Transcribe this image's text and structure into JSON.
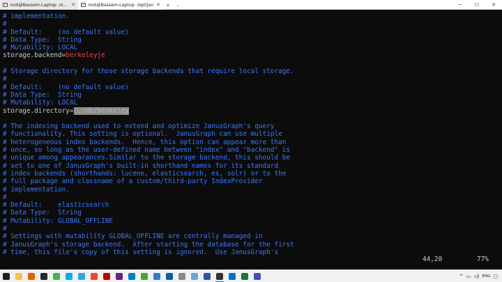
{
  "window": {
    "tabs": [
      {
        "label": "root@Bassem-Laptop: /opt/jan",
        "active": false
      },
      {
        "label": "root@Bassem-Laptop: /opt/jan",
        "active": true
      }
    ],
    "new_tab": "+",
    "dropdown": "⌄",
    "minimize": "─",
    "maximize": "☐",
    "close": "✕"
  },
  "terminal": {
    "lines": [
      {
        "type": "comment",
        "text": "# implementation."
      },
      {
        "type": "comment",
        "text": "#"
      },
      {
        "type": "comment",
        "text": "# Default:    (no default value)"
      },
      {
        "type": "comment",
        "text": "# Data Type:  String"
      },
      {
        "type": "comment",
        "text": "# Mutability: LOCAL"
      },
      {
        "type": "setting",
        "key": "storage.backend=",
        "value": "berkeleyje"
      },
      {
        "type": "blank",
        "text": ""
      },
      {
        "type": "comment",
        "text": "# Storage directory for those storage backends that require local storage."
      },
      {
        "type": "comment",
        "text": "#"
      },
      {
        "type": "comment",
        "text": "# Default:    (no default value)"
      },
      {
        "type": "comment",
        "text": "# Data Type:  String"
      },
      {
        "type": "comment",
        "text": "# Mutability: LOCAL"
      },
      {
        "type": "setting-selected",
        "key": "storage.directory=",
        "value": "../db/berkeley"
      },
      {
        "type": "blank",
        "text": ""
      },
      {
        "type": "comment",
        "text": "# The indexing backend used to extend and optimize JanusGraph's query"
      },
      {
        "type": "comment",
        "text": "# functionality. This setting is optional.  JanusGraph can use multiple"
      },
      {
        "type": "comment",
        "text": "# heterogeneous index backends.  Hence, this option can appear more than"
      },
      {
        "type": "comment",
        "text": "# once, so long as the user-defined name between \"index\" and \"backend\" is"
      },
      {
        "type": "comment",
        "text": "# unique among appearances.Similar to the storage backend, this should be"
      },
      {
        "type": "comment",
        "text": "# set to one of JanusGraph's built-in shorthand names for its standard"
      },
      {
        "type": "comment",
        "text": "# index backends (shorthands: lucene, elasticsearch, es, solr) or to the"
      },
      {
        "type": "comment",
        "text": "# full package and classname of a custom/third-party IndexProvider"
      },
      {
        "type": "comment",
        "text": "# implementation."
      },
      {
        "type": "comment",
        "text": "#"
      },
      {
        "type": "comment",
        "text": "# Default:    elasticsearch"
      },
      {
        "type": "comment",
        "text": "# Data Type:  String"
      },
      {
        "type": "comment",
        "text": "# Mutability: GLOBAL_OFFLINE"
      },
      {
        "type": "comment",
        "text": "#"
      },
      {
        "type": "comment",
        "text": "# Settings with mutability GLOBAL_OFFLINE are centrally managed in"
      },
      {
        "type": "comment",
        "text": "# JanusGraph's storage backend.  After starting the database for the first"
      },
      {
        "type": "comment",
        "text": "# time, this file's copy of this setting is ignored.  Use JanusGraph's"
      }
    ],
    "status_position": "44,20",
    "status_percent": "77%"
  },
  "taskbar": {
    "icons": [
      {
        "name": "start-icon",
        "color": "#1e1e1e"
      },
      {
        "name": "file-explorer-icon",
        "color": "#f3c34a"
      },
      {
        "name": "firefox-icon",
        "color": "#e66000"
      },
      {
        "name": "github-desktop-icon",
        "color": "#24292e"
      },
      {
        "name": "chrome-icon",
        "color": "#4caf50"
      },
      {
        "name": "skype-icon",
        "color": "#00aff0"
      },
      {
        "name": "notepad-icon",
        "color": "#3aa0e0"
      },
      {
        "name": "git-gui-icon",
        "color": "#e44c30"
      },
      {
        "name": "filezilla-icon",
        "color": "#bf0000"
      },
      {
        "name": "visual-studio-icon",
        "color": "#68217a"
      },
      {
        "name": "vscode-icon",
        "color": "#007acc"
      },
      {
        "name": "anaconda-icon",
        "color": "#44a833"
      },
      {
        "name": "network-tool-icon",
        "color": "#2d7dd2"
      },
      {
        "name": "remote-desktop-icon",
        "color": "#0a5ea8"
      },
      {
        "name": "app-icon",
        "color": "#888888"
      },
      {
        "name": "photo-viewer-icon",
        "color": "#6aa5d8"
      },
      {
        "name": "word-icon",
        "color": "#2b579a"
      },
      {
        "name": "terminal-icon",
        "color": "#333333",
        "active": true
      },
      {
        "name": "outlook-icon",
        "color": "#0072c6"
      },
      {
        "name": "excel-icon",
        "color": "#217346"
      },
      {
        "name": "teams-icon",
        "color": "#464eb8"
      }
    ],
    "tray": {
      "chevron": "^",
      "network": "▭",
      "volume": "◁)",
      "language": "ENG",
      "notifications": "▢"
    }
  }
}
